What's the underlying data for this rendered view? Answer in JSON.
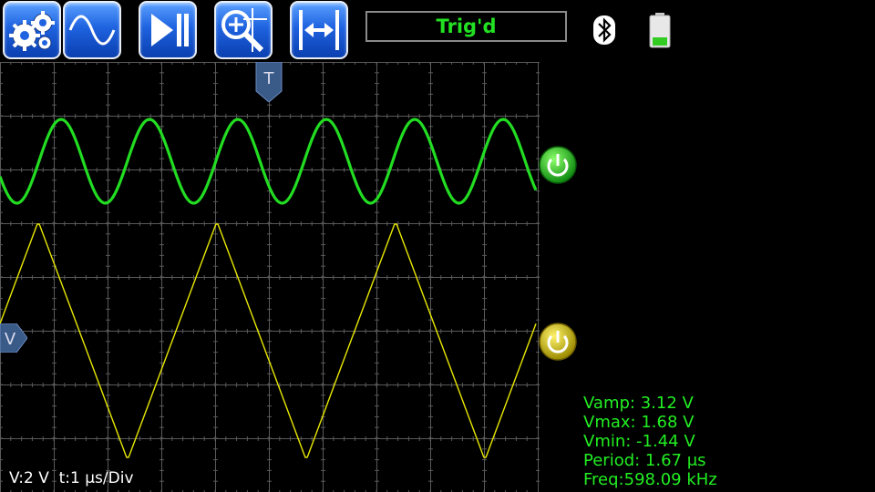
{
  "toolbar": {
    "buttons": [
      {
        "name": "settings",
        "icon": "gears-icon"
      },
      {
        "name": "waveform",
        "icon": "sine-wave-icon"
      },
      {
        "name": "run-stop",
        "icon": "play-pause-icon"
      },
      {
        "name": "zoom",
        "icon": "zoom-cursor-icon"
      },
      {
        "name": "fit-horizontal",
        "icon": "horizontal-fit-icon"
      }
    ]
  },
  "status": {
    "text": "Trig'd",
    "color": "#22e022"
  },
  "scope": {
    "background": "#000000",
    "grid_color": "#5a5a5a",
    "ch1": {
      "color": "#22dd22",
      "shape": "sine",
      "period_us": 1.67
    },
    "ch2": {
      "color": "#e8e800",
      "shape": "triangle"
    },
    "markers": {
      "trigger_label": "T",
      "vertical_label": "V"
    }
  },
  "scale": {
    "text": "V:2 V  t:1 μs/Div"
  },
  "measurements": {
    "vamp": "Vamp: 3.12 V",
    "vmax": "Vmax: 1.68 V",
    "vmin": "Vmin: -1.44 V",
    "period": "Period: 1.67 μs",
    "freq": "Freq:598.09 kHz"
  }
}
